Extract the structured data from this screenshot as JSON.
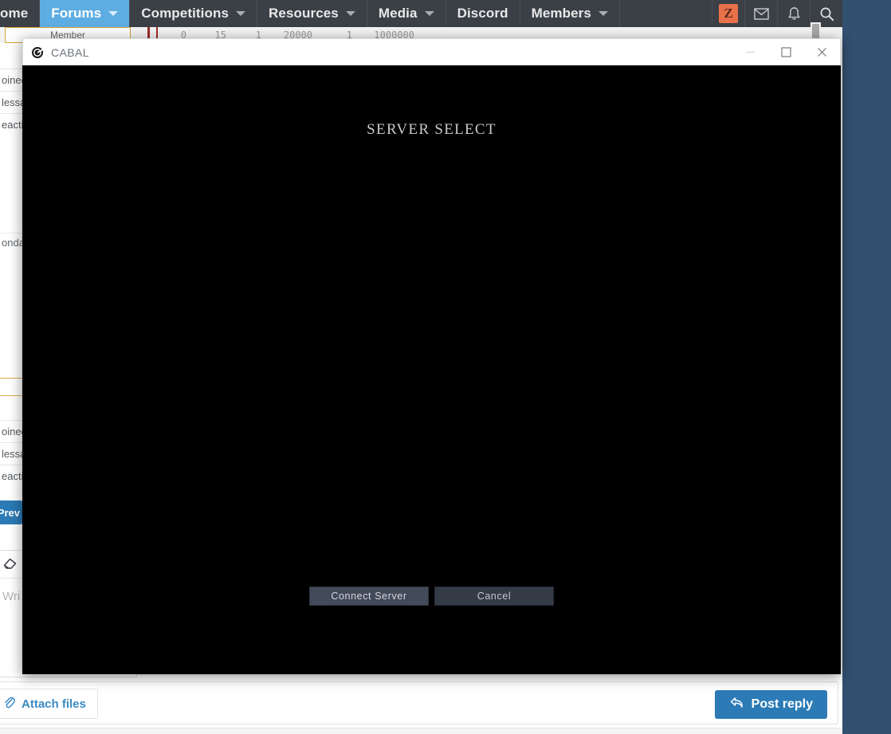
{
  "desktop": {
    "background_color": "#32506f"
  },
  "forum": {
    "nav": {
      "items": [
        {
          "label": "ome",
          "has_caret": false,
          "active": false,
          "name": "home"
        },
        {
          "label": "Forums",
          "has_caret": true,
          "active": true,
          "name": "forums"
        },
        {
          "label": "Competitions",
          "has_caret": true,
          "active": false,
          "name": "competitions"
        },
        {
          "label": "Resources",
          "has_caret": true,
          "active": false,
          "name": "resources"
        },
        {
          "label": "Media",
          "has_caret": true,
          "active": false,
          "name": "media"
        },
        {
          "label": "Discord",
          "has_caret": false,
          "active": false,
          "name": "discord"
        },
        {
          "label": "Members",
          "has_caret": true,
          "active": false,
          "name": "members"
        }
      ],
      "avatar_initial": "Z",
      "avatar_color": "#e8714a",
      "icons": [
        "envelope-icon",
        "bell-icon",
        "search-icon"
      ],
      "active_color": "#5dade2",
      "bar_color": "#3b3f46"
    },
    "numstrip": {
      "member_label": "Member",
      "values": [
        "0",
        "15",
        "1",
        "20000",
        "1",
        "1000000"
      ]
    },
    "stats_block_1": [
      {
        "label": "oined"
      },
      {
        "label": "lessa"
      },
      {
        "label": "eacti"
      }
    ],
    "stats_block_2": [
      {
        "label": "oined"
      },
      {
        "label": "lessa"
      },
      {
        "label": "eacti"
      }
    ],
    "date_row": {
      "label": "onday"
    },
    "pagination": {
      "prev_label": "Prev"
    },
    "editor": {
      "eraser_icon": "eraser-icon",
      "placeholder": "Wri"
    },
    "bottom": {
      "attach_label": "Attach files",
      "attach_icon": "paperclip-icon",
      "post_label": "Post reply",
      "post_icon": "reply-arrow-icon",
      "post_color": "#2c7bb6"
    }
  },
  "game_window": {
    "title": "CABAL",
    "title_icon": "cabal-logo-icon",
    "controls": {
      "minimize": "minimize-icon",
      "maximize": "maximize-icon",
      "close": "close-icon"
    },
    "screen": {
      "heading": "SERVER SELECT",
      "background_color": "#000000",
      "buttons": [
        {
          "label": "Connect Server",
          "primary": true,
          "name": "connect-server-button"
        },
        {
          "label": "Cancel",
          "primary": false,
          "name": "cancel-button"
        }
      ]
    }
  }
}
